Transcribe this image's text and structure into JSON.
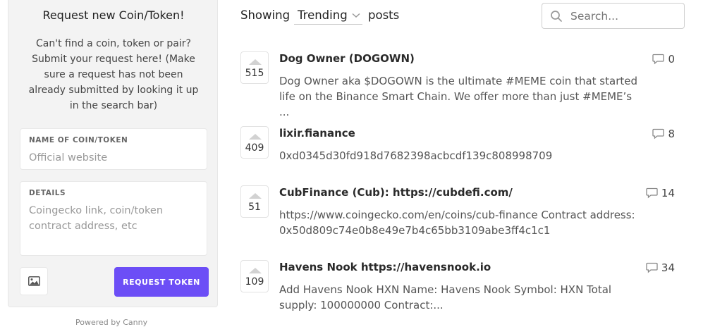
{
  "sidebar": {
    "title": "Request new Coin/Token!",
    "description": "Can't find a coin, token or pair? Submit your request here! (Make sure a request has not been already submitted by looking it up in the search bar)",
    "name_label": "NAME OF COIN/TOKEN",
    "name_placeholder": "Official website",
    "details_label": "DETAILS",
    "details_placeholder": "Coingecko link, coin/token contract address, etc",
    "submit_label": "REQUEST TOKEN",
    "powered_by": "Powered by Canny"
  },
  "toolbar": {
    "showing_label": "Showing",
    "sort_value": "Trending",
    "posts_label": "posts",
    "search_placeholder": "Search..."
  },
  "posts": [
    {
      "votes": "515",
      "title": "Dog Owner (DOGOWN)",
      "description": "Dog Owner aka $DOGOWN is the ultimate #MEME coin that started life on the Binance Smart Chain. We offer more than just #MEME’s ...",
      "comments": "0"
    },
    {
      "votes": "409",
      "title": "lixir.fianance",
      "description": "0xd0345d30fd918d7682398acbcdf139c808998709",
      "comments": "8"
    },
    {
      "votes": "51",
      "title": "CubFinance (Cub): https://cubdefi.com/",
      "description": "https://www.coingecko.com/en/coins/cub-finance Contract address: 0x50d809c74e0b8e49e7b4c65bb3109abe3ff4c1c1",
      "comments": "14"
    },
    {
      "votes": "109",
      "title": "Havens Nook https://havensnook.io",
      "description": "Add Havens Nook HXN Name: Havens Nook Symbol: HXN Total supply: 100000000 Contract:...",
      "comments": "34"
    }
  ],
  "colors": {
    "accent": "#6c4ef6",
    "sidebar_bg": "#f3f3f3"
  }
}
